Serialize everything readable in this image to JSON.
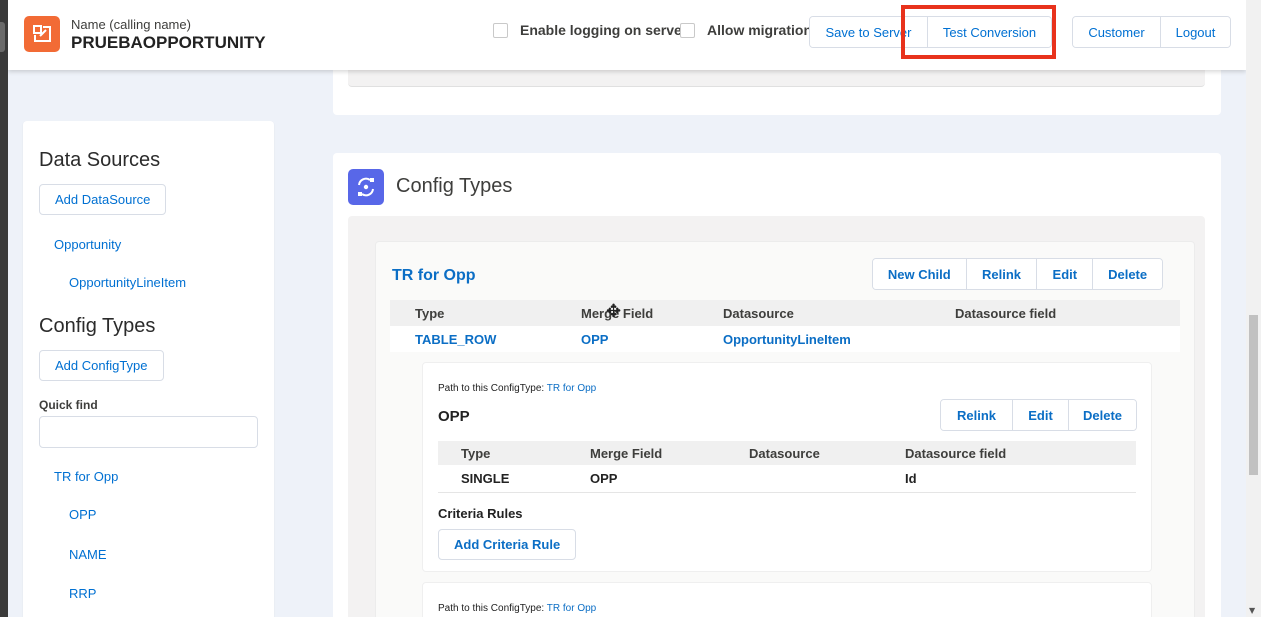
{
  "header": {
    "logo_icon": "document-template-icon",
    "name_label": "Name (calling name)",
    "name_value": "PRUEBAOPPORTUNITY",
    "enable_logging_label": "Enable logging on server",
    "allow_migration_label": "Allow migration",
    "save_to_server_label": "Save to Server",
    "test_conversion_label": "Test Conversion",
    "customer_label": "Customer",
    "logout_label": "Logout",
    "highlight_color": "#e8321c"
  },
  "sidebar": {
    "data_sources_heading": "Data Sources",
    "add_datasource_label": "Add DataSource",
    "datasources": [
      "Opportunity",
      "OpportunityLineItem"
    ],
    "config_types_heading": "Config Types",
    "add_configtype_label": "Add ConfigType",
    "quick_find_label": "Quick find",
    "quick_find_value": "",
    "config_types": [
      "TR for Opp",
      "OPP",
      "NAME",
      "RRP"
    ]
  },
  "main": {
    "section_icon": "config-types-icon",
    "section_title": "Config Types",
    "tr_card": {
      "title": "TR for Opp",
      "actions": [
        "New Child",
        "Relink",
        "Edit",
        "Delete"
      ],
      "columns": [
        "Type",
        "Merge Field",
        "Datasource",
        "Datasource field"
      ],
      "row": {
        "type": "TABLE_ROW",
        "merge_field": "OPP",
        "datasource": "OpportunityLineItem",
        "datasource_field": ""
      }
    },
    "child_card": {
      "path_label": "Path to this ConfigType:",
      "path_link": "TR for Opp",
      "title": "OPP",
      "actions": [
        "Relink",
        "Edit",
        "Delete"
      ],
      "columns": [
        "Type",
        "Merge Field",
        "Datasource",
        "Datasource field"
      ],
      "row": {
        "type": "SINGLE",
        "merge_field": "OPP",
        "datasource": "",
        "datasource_field": "Id"
      },
      "criteria_label": "Criteria Rules",
      "add_criteria_label": "Add Criteria Rule"
    },
    "next_child_card": {
      "path_label": "Path to this ConfigType:",
      "path_link": "TR for Opp"
    }
  },
  "colors": {
    "accent": "#0070d2",
    "logo_bg": "#f26b35",
    "config_icon_bg": "#5867e8",
    "page_bg": "#eef2f9"
  }
}
